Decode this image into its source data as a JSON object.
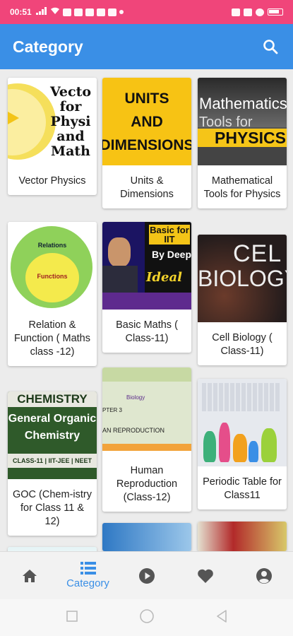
{
  "status_bar": {
    "time": "00:51",
    "battery": "battery-icon"
  },
  "app_bar": {
    "title": "Category",
    "search_icon": "search-icon"
  },
  "categories": [
    {
      "label": "Vector Physics",
      "thumb_text": [
        "Vecto",
        "for",
        "Physi",
        "and",
        "Math"
      ]
    },
    {
      "label": "Units & Dimensions",
      "thumb_text": [
        "UNITS",
        "AND",
        "DIMENSIONS"
      ]
    },
    {
      "label": "Mathematical Tools for Physics",
      "thumb_text": [
        "Mathematics",
        "Tools for",
        "PHYSICS"
      ]
    },
    {
      "label": "Relation & Function ( Maths class -12)",
      "thumb_text": [
        "Relations",
        "Functions"
      ]
    },
    {
      "label": "Basic Maths ( Class-11)",
      "thumb_text": [
        "Basic for IIT",
        "By Deep",
        "Ideal"
      ]
    },
    {
      "label": "Cell Biology ( Class-11)",
      "thumb_text": [
        "CEL",
        "BIOLOGY"
      ]
    },
    {
      "label": "GOC (Chem-istry for Class 11 & 12)",
      "thumb_text": [
        "CHEMISTRY",
        "General Organic",
        "Chemistry",
        "CLASS-11 | IIT-JEE | NEET"
      ]
    },
    {
      "label": "Human Reproduction (Class-12)",
      "thumb_text": [
        "Biology",
        "PTER 3",
        "AN REPRODUCTION"
      ]
    },
    {
      "label": "Periodic Table for Class11",
      "thumb_text": []
    }
  ],
  "bottom_nav": [
    {
      "name": "home",
      "icon": "home-icon",
      "label": ""
    },
    {
      "name": "category",
      "icon": "list-icon",
      "label": "Category",
      "active": true
    },
    {
      "name": "videos",
      "icon": "play-icon",
      "label": ""
    },
    {
      "name": "favorites",
      "icon": "heart-icon",
      "label": ""
    },
    {
      "name": "profile",
      "icon": "account-icon",
      "label": ""
    }
  ],
  "colors": {
    "status_bar": "#f0457a",
    "app_bar": "#3a8fe6",
    "active_nav": "#3a8fe6",
    "nav_icon": "#555555"
  }
}
